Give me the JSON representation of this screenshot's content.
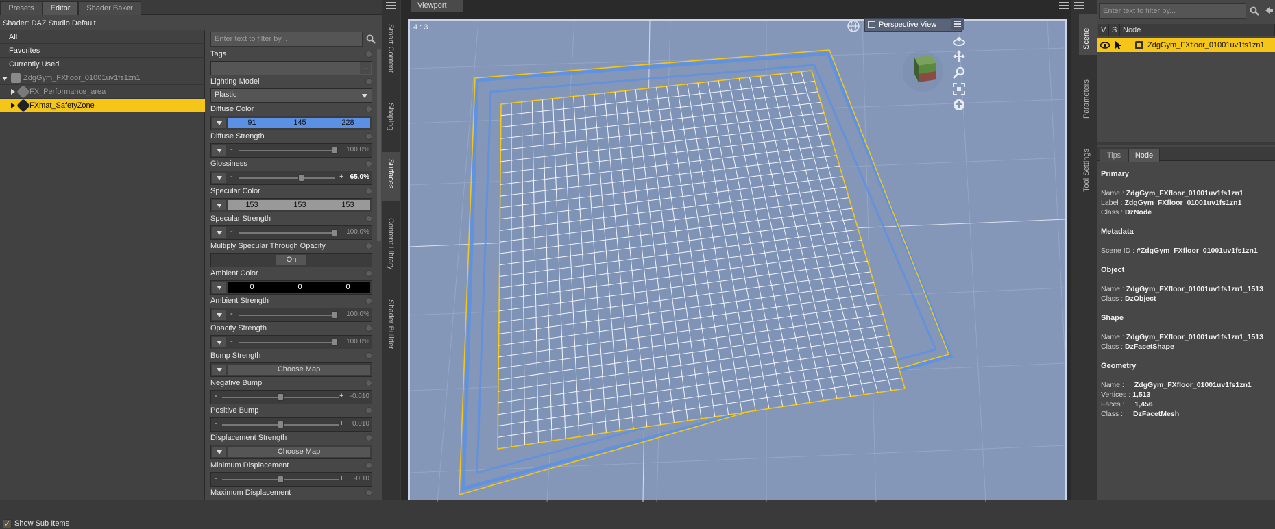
{
  "left_tabs": [
    "Presets",
    "Editor",
    "Shader Baker"
  ],
  "shader_title": "Shader: DAZ Studio Default",
  "tree": {
    "items": [
      {
        "label": "All"
      },
      {
        "label": "Favorites"
      },
      {
        "label": "Currently Used"
      },
      {
        "label": "ZdgGym_FXfloor_01001uv1fs1zn1"
      },
      {
        "label": "FX_Performance_area"
      },
      {
        "label": "FXmat_SafetyZone"
      }
    ],
    "show_sub_items": "Show Sub Items"
  },
  "props": {
    "filter_placeholder": "Enter text to filter by...",
    "tags": "Tags",
    "tags_btn": "...",
    "lighting_model": {
      "label": "Lighting Model",
      "value": "Plastic"
    },
    "diffuse_color": {
      "label": "Diffuse Color",
      "r": "91",
      "g": "145",
      "b": "228",
      "swatch": "#5b91e4"
    },
    "diffuse_strength": {
      "label": "Diffuse Strength",
      "value": "100.0%",
      "level": 1.0
    },
    "glossiness": {
      "label": "Glossiness",
      "value": "65.0%",
      "level": 0.65
    },
    "specular_color": {
      "label": "Specular Color",
      "r": "153",
      "g": "153",
      "b": "153",
      "swatch": "#999999"
    },
    "specular_strength": {
      "label": "Specular Strength",
      "value": "100.0%",
      "level": 1.0
    },
    "multiply_specular": {
      "label": "Multiply Specular Through Opacity",
      "value": "On"
    },
    "ambient_color": {
      "label": "Ambient Color",
      "r": "0",
      "g": "0",
      "b": "0",
      "swatch": "#000000"
    },
    "ambient_strength": {
      "label": "Ambient Strength",
      "value": "100.0%",
      "level": 1.0
    },
    "opacity_strength": {
      "label": "Opacity Strength",
      "value": "100.0%",
      "level": 1.0
    },
    "bump_strength": {
      "label": "Bump Strength",
      "button": "Choose Map"
    },
    "negative_bump": {
      "label": "Negative Bump",
      "value": "-0.010",
      "level": 0.5
    },
    "positive_bump": {
      "label": "Positive Bump",
      "value": "0.010",
      "level": 0.5
    },
    "displacement_strength": {
      "label": "Displacement Strength",
      "button": "Choose Map"
    },
    "minimum_displacement": {
      "label": "Minimum Displacement",
      "value": "-0.10",
      "level": 0.5
    },
    "maximum_displacement": {
      "label": "Maximum Displacement"
    }
  },
  "side_tabs_left": [
    "Smart Content",
    "Shaping",
    "Surfaces",
    "Content Library",
    "Shader Builder"
  ],
  "viewport": {
    "tab": "Viewport",
    "aspect": "4 : 3",
    "view": "Perspective View"
  },
  "side_tabs_right": [
    "Scene",
    "Parameters",
    "Tool Settings"
  ],
  "scene": {
    "filter_placeholder": "Enter text to filter by...",
    "headers": [
      "V",
      "S",
      "Node"
    ],
    "node": "ZdgGym_FXfloor_01001uv1fs1zn1"
  },
  "info_tabs": [
    "Tips",
    "Node"
  ],
  "info": {
    "primary": {
      "title": "Primary",
      "name_label": "Name :",
      "name": "ZdgGym_FXfloor_01001uv1fs1zn1",
      "label_label": "Label :",
      "label": "ZdgGym_FXfloor_01001uv1fs1zn1",
      "class_label": "Class :",
      "class": "DzNode"
    },
    "metadata": {
      "title": "Metadata",
      "scene_id_label": "Scene ID :",
      "scene_id": "#ZdgGym_FXfloor_01001uv1fs1zn1"
    },
    "object": {
      "title": "Object",
      "name_label": "Name :",
      "name": "ZdgGym_FXfloor_01001uv1fs1zn1_1513",
      "class_label": "Class :",
      "class": "DzObject"
    },
    "shape": {
      "title": "Shape",
      "name_label": "Name :",
      "name": "ZdgGym_FXfloor_01001uv1fs1zn1_1513",
      "class_label": "Class :",
      "class": "DzFacetShape"
    },
    "geometry": {
      "title": "Geometry",
      "name_label": "Name :",
      "name": "ZdgGym_FXfloor_01001uv1fs1zn1",
      "vertices_label": "Vertices :",
      "vertices": "1,513",
      "faces_label": "Faces :",
      "faces": "1,456",
      "class_label": "Class :",
      "class": "DzFacetMesh"
    }
  },
  "colors": {
    "selection": "#f5c518",
    "viewport_bg": "#8497b8",
    "wire_blue": "#5b91e4"
  }
}
